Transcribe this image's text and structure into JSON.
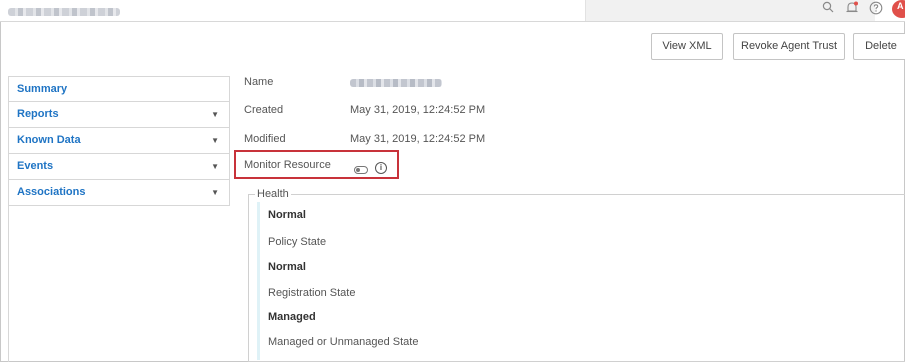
{
  "header": {
    "title_redacted": true,
    "icons": [
      "search-icon",
      "bell-icon",
      "help-icon"
    ],
    "avatar_initial": "A"
  },
  "toolbar": {
    "view_xml": "View XML",
    "revoke_agent_trust": "Revoke Agent Trust",
    "delete": "Delete"
  },
  "sidebar": {
    "items": [
      {
        "label": "Summary",
        "has_caret": false
      },
      {
        "label": "Reports",
        "has_caret": true
      },
      {
        "label": "Known Data",
        "has_caret": true
      },
      {
        "label": "Events",
        "has_caret": true
      },
      {
        "label": "Associations",
        "has_caret": true
      }
    ],
    "caret": "▼"
  },
  "details": {
    "name_label": "Name",
    "created_label": "Created",
    "created_value": "May 31, 2019, 12:24:52 PM",
    "modified_label": "Modified",
    "modified_value": "May 31, 2019, 12:24:52 PM",
    "monitor_label": "Monitor Resource",
    "monitor_enabled": false,
    "info_glyph": "i"
  },
  "health": {
    "legend": "Health",
    "status_value": "Normal",
    "policy_label": "Policy State",
    "policy_value": "Normal",
    "registration_label": "Registration State",
    "registration_value": "Managed",
    "managed_label": "Managed or Unmanaged State"
  },
  "colors": {
    "link_blue": "#1f74c4",
    "highlight_red": "#c8323a",
    "avatar_red": "#e0504a"
  }
}
